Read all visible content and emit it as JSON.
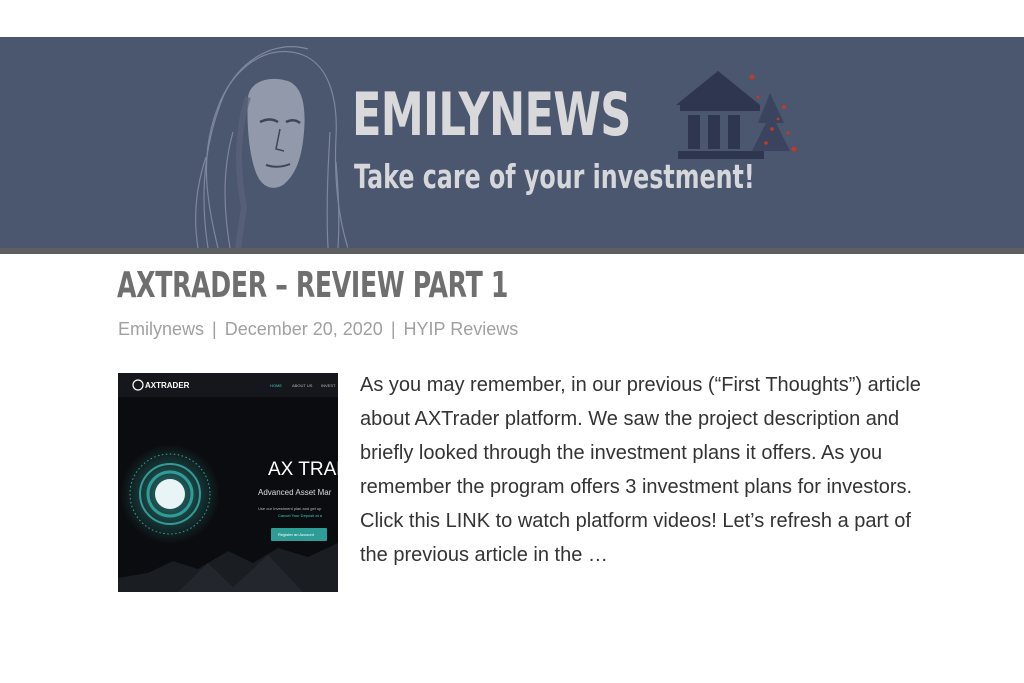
{
  "site": {
    "title": "EMILYNEWS",
    "tagline": "Take care of your investment!"
  },
  "post": {
    "title": "AXTRADER – REVIEW PART 1",
    "author": "Emilynews",
    "date": "December 20, 2020",
    "category": "HYIP Reviews",
    "separator": "|",
    "excerpt": "As you may remember, in our previous (“First Thoughts”) article about AXTrader platform. We saw the project description and briefly looked through the investment plans it offers. As you remember the program offers 3 investment plans for investors. Click this LINK to watch platform videos! Let’s refresh a part of the previous article in the …"
  },
  "thumbnail": {
    "logo": "AXTRADER",
    "nav": [
      "HOME",
      "ABOUT US",
      "INVEST"
    ],
    "heading": "AX TRAD",
    "subheading": "Advanced Asset Mar",
    "line1": "Use our Investment plan and get up",
    "line2": "Cancel Your Deposit at a",
    "cta": "Register an Account"
  },
  "colors": {
    "banner": "#4b566f",
    "accent": "#3fc8c0"
  },
  "icons": {
    "portrait": "woman-portrait-sketch",
    "logo": "bank-building-icon"
  }
}
